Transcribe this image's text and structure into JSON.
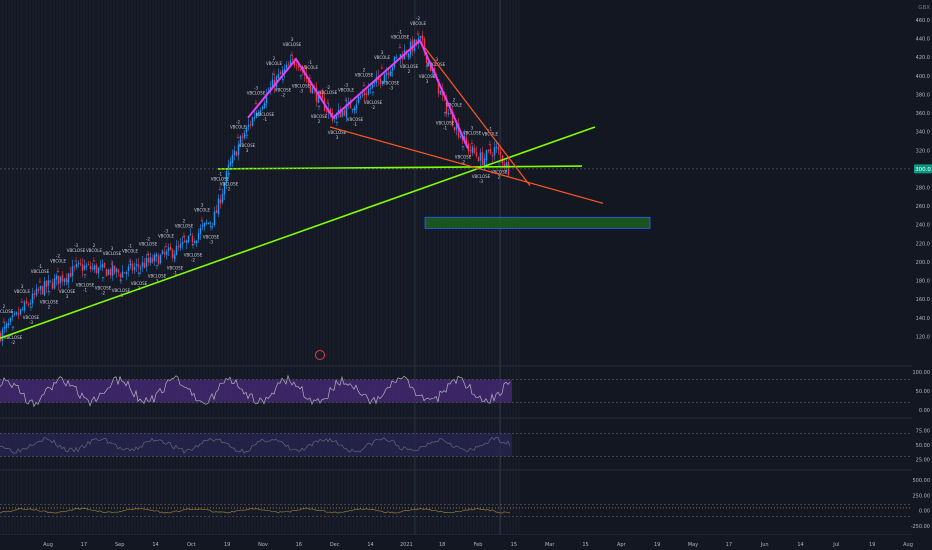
{
  "chart_data": {
    "type": "candlestick",
    "currency_label": "GBX",
    "price_axis": {
      "range": [
        100,
        460
      ],
      "ticks": [
        460.0,
        440.0,
        420.0,
        400.0,
        380.0,
        360.0,
        340.0,
        320.0,
        300.0,
        280.0,
        260.0,
        240.0,
        220.0,
        200.0,
        180.0,
        160.0,
        140.0,
        120.0
      ],
      "tick_labels": [
        "460.0",
        "440.0",
        "420.0",
        "400.0",
        "380.0",
        "360.0",
        "340.0",
        "320.0",
        "300.0",
        "280.0",
        "260.0",
        "240.0",
        "220.0",
        "200.0",
        "180.0",
        "160.0",
        "140.0",
        "120.0"
      ],
      "last_price": "300.0"
    },
    "time_axis": {
      "labels": [
        "Aug",
        "17",
        "Sep",
        "14",
        "Oct",
        "19",
        "Nov",
        "16",
        "Dec",
        "14",
        "2021",
        "18",
        "Feb",
        "15",
        "Mar",
        "15",
        "Apr",
        "19",
        "May",
        "17",
        "Jun",
        "14",
        "Jul",
        "19",
        "Aug"
      ]
    },
    "price_anchors": [
      {
        "t": 0,
        "p": 122
      },
      {
        "t": 40,
        "p": 170
      },
      {
        "t": 80,
        "p": 195
      },
      {
        "t": 120,
        "p": 188
      },
      {
        "t": 150,
        "p": 200
      },
      {
        "t": 180,
        "p": 215
      },
      {
        "t": 195,
        "p": 228
      },
      {
        "t": 215,
        "p": 250
      },
      {
        "t": 228,
        "p": 300
      },
      {
        "t": 240,
        "p": 330
      },
      {
        "t": 255,
        "p": 360
      },
      {
        "t": 275,
        "p": 395
      },
      {
        "t": 296,
        "p": 418
      },
      {
        "t": 312,
        "p": 385
      },
      {
        "t": 333,
        "p": 355
      },
      {
        "t": 355,
        "p": 372
      },
      {
        "t": 378,
        "p": 395
      },
      {
        "t": 398,
        "p": 420
      },
      {
        "t": 420,
        "p": 438
      },
      {
        "t": 435,
        "p": 395
      },
      {
        "t": 448,
        "p": 360
      },
      {
        "t": 468,
        "p": 322
      },
      {
        "t": 482,
        "p": 310
      },
      {
        "t": 495,
        "p": 322
      },
      {
        "t": 508,
        "p": 300
      }
    ],
    "patterns": {
      "zigzag": [
        {
          "t": 248,
          "p": 355
        },
        {
          "t": 296,
          "p": 418
        },
        {
          "t": 333,
          "p": 355
        },
        {
          "t": 420,
          "p": 438
        },
        {
          "t": 468,
          "p": 322
        }
      ],
      "neckline": {
        "from": {
          "t": 218,
          "p": 300
        },
        "to": {
          "t": 582,
          "p": 303
        }
      },
      "rising_trendline": {
        "from": {
          "t": 0,
          "p": 118
        },
        "to": {
          "t": 595,
          "p": 345
        }
      },
      "falling_channel_lower": {
        "from": {
          "t": 330,
          "p": 345
        },
        "to": {
          "t": 603,
          "p": 263
        }
      },
      "falling_channel_upper": {
        "from": {
          "t": 425,
          "p": 430
        },
        "to": {
          "t": 530,
          "p": 282
        }
      },
      "target_zone": {
        "t_start": 425,
        "t_end": 650,
        "p_low": 236,
        "p_high": 248
      }
    },
    "signal_texts": [
      "VBCLOSE",
      "VBCLOSE",
      "VBCOLE",
      "VBCOSE"
    ],
    "signal_counts": [
      "2",
      "-2",
      "3",
      "-3",
      "-1"
    ],
    "oscillator_1": {
      "ticks": [
        "100.00",
        "50.00",
        "0.00"
      ],
      "band": [
        20,
        80
      ]
    },
    "oscillator_2": {
      "ticks": [
        "75.00",
        "50.00",
        "25.00"
      ],
      "band": [
        30,
        70
      ]
    },
    "oscillator_3": {
      "ticks": [
        "500.00",
        "250.00",
        "0.00",
        "-250.00"
      ],
      "band": [
        -100,
        100
      ]
    },
    "colors": {
      "background": "#131722",
      "up": "#2196f3",
      "down": "#f23645",
      "zigzag": "#e040fb",
      "trend_green": "#7fff00",
      "channel_red": "#ff5722",
      "target_zone": "#1b5e20",
      "osc_band": "#4a2a7a",
      "last_price_bg": "#089981"
    }
  }
}
